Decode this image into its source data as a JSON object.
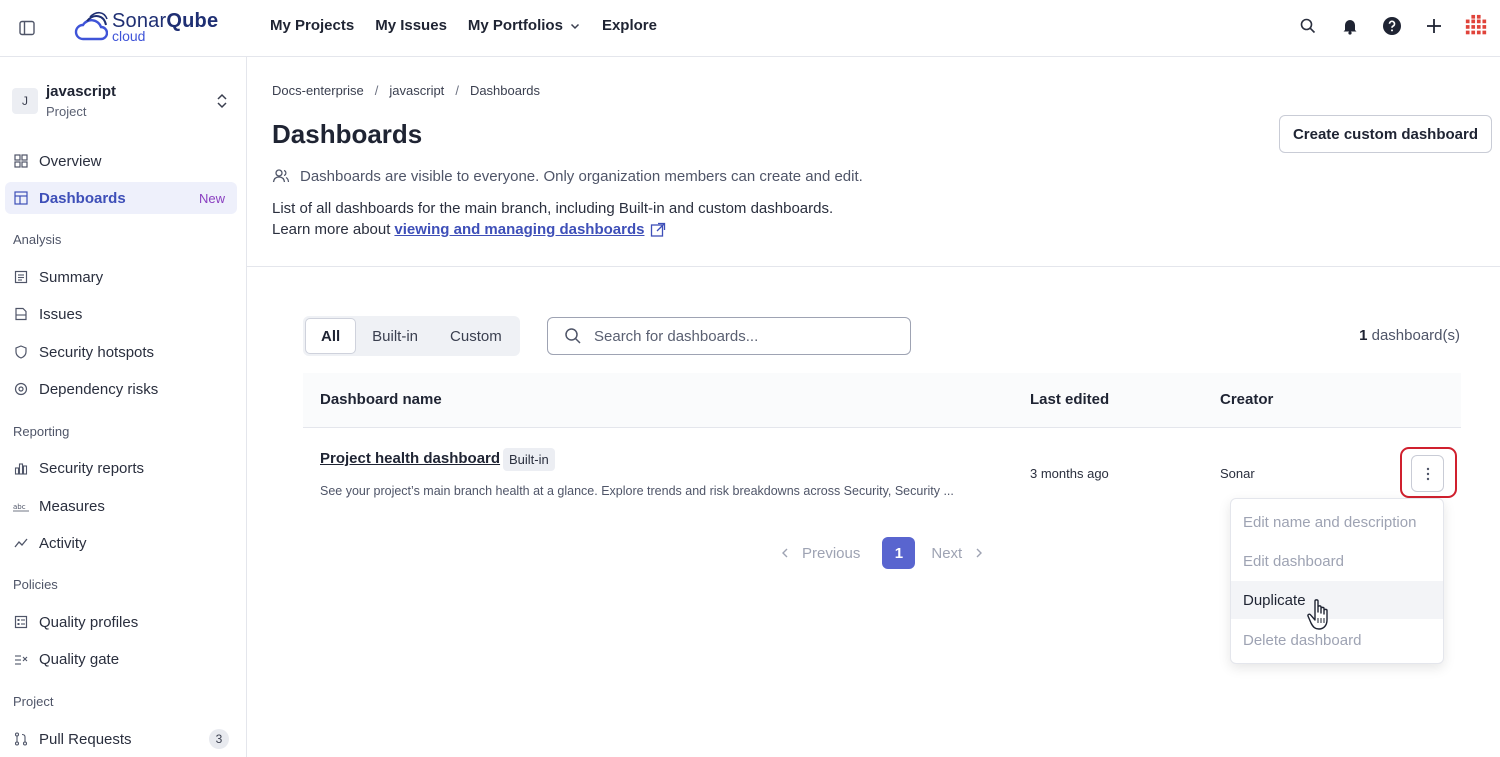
{
  "topbar": {
    "logo_brand_a": "Sonar",
    "logo_brand_b": "Qube",
    "logo_sub": "cloud",
    "nav": [
      "My Projects",
      "My Issues",
      "My Portfolios",
      "Explore"
    ]
  },
  "project": {
    "avatar": "J",
    "name": "javascript",
    "type": "Project"
  },
  "sidebar": {
    "overview": "Overview",
    "dashboards": "Dashboards",
    "dashboards_badge": "New",
    "sections": {
      "analysis": "Analysis",
      "reporting": "Reporting",
      "policies": "Policies",
      "project": "Project"
    },
    "analysis_items": [
      "Summary",
      "Issues",
      "Security hotspots",
      "Dependency risks"
    ],
    "reporting_items": [
      "Security reports",
      "Measures",
      "Activity"
    ],
    "policies_items": [
      "Quality profiles",
      "Quality gate"
    ],
    "project_items": [
      "Pull Requests"
    ],
    "pull_requests_count": "3"
  },
  "breadcrumb": [
    "Docs-enterprise",
    "javascript",
    "Dashboards"
  ],
  "page": {
    "title": "Dashboards",
    "create_button": "Create custom dashboard",
    "visibility_note": "Dashboards are visible to everyone. Only organization members can create and edit.",
    "description": "List of all dashboards for the main branch, including Built-in and custom dashboards.",
    "learn_more_prefix": "Learn more about",
    "learn_more_link": "viewing and managing dashboards"
  },
  "filters": {
    "options": [
      "All",
      "Built-in",
      "Custom"
    ],
    "selected": "All",
    "search_placeholder": "Search for dashboards...",
    "count_num": "1",
    "count_label": "dashboard(s)"
  },
  "table": {
    "headers": [
      "Dashboard name",
      "Last edited",
      "Creator"
    ],
    "rows": [
      {
        "name": "Project health dashboard",
        "tag": "Built-in",
        "description": "See your project’s main branch health at a glance. Explore trends and risk breakdowns across Security, Security ...",
        "last_edited": "3 months ago",
        "creator": "Sonar"
      }
    ]
  },
  "pagination": {
    "previous": "Previous",
    "current": "1",
    "next": "Next"
  },
  "menu": {
    "items": [
      "Edit name and description",
      "Edit dashboard",
      "Duplicate",
      "Delete dashboard"
    ],
    "hovered": "Duplicate"
  },
  "colors": {
    "accent": "#5965cf",
    "link": "#3e4fb8",
    "highlight_box": "#d0202e",
    "new_badge": "#8a3fc0"
  }
}
